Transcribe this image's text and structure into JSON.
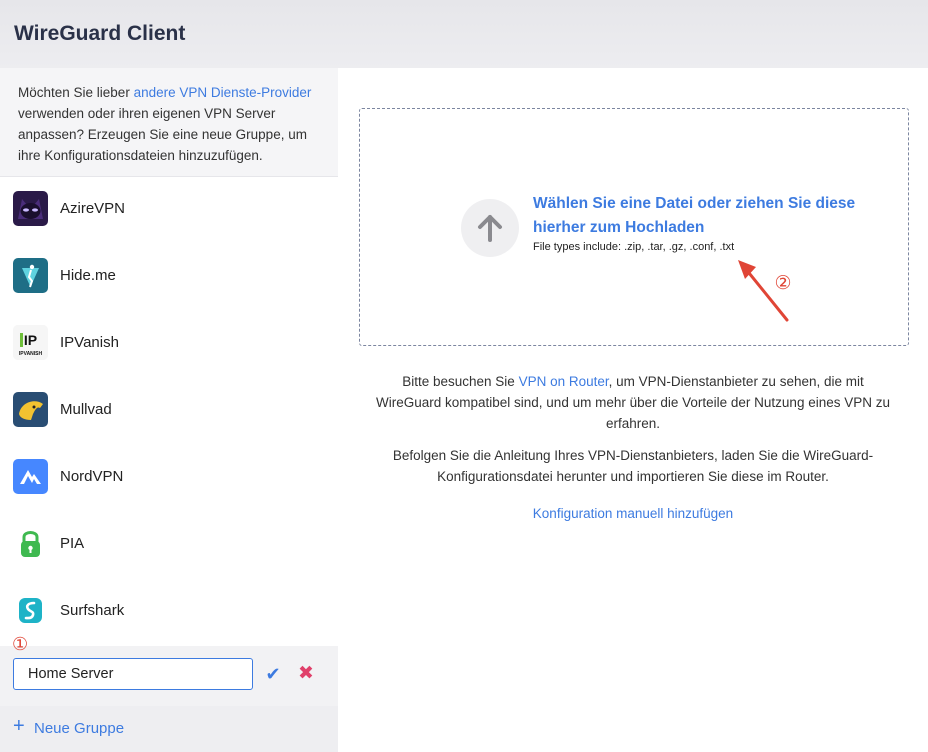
{
  "app": {
    "title": "WireGuard Client"
  },
  "sidebar": {
    "intro": {
      "before": "Möchten Sie lieber ",
      "link": "andere VPN Dienste-Provider",
      "after": " verwenden oder ihren eigenen VPN Server anpassen? Erzeugen Sie eine neue Gruppe, um ihre Konfigurationsdateien hinzuzufügen."
    },
    "providers": [
      {
        "name": "AzireVPN",
        "icon": "azirevpn-logo",
        "color": "#2d1a4e"
      },
      {
        "name": "Hide.me",
        "icon": "hideme-logo",
        "color": "#1f6f86"
      },
      {
        "name": "IPVanish",
        "icon": "ipvanish-logo",
        "color": "#111111",
        "logo_text": "IPVANISH"
      },
      {
        "name": "Mullvad",
        "icon": "mullvad-logo",
        "color": "#294d73"
      },
      {
        "name": "NordVPN",
        "icon": "nordvpn-logo",
        "color": "#4687ff"
      },
      {
        "name": "PIA",
        "icon": "pia-logo",
        "color": "#3fb950"
      },
      {
        "name": "Surfshark",
        "icon": "surfshark-logo",
        "color": "#1fb4c8"
      }
    ],
    "group_input": {
      "value": "Home Server",
      "placeholder": ""
    },
    "new_group_label": "Neue Gruppe"
  },
  "main": {
    "upload": {
      "title": "Wählen Sie eine Datei oder ziehen Sie diese hierher zum Hochladen",
      "filetypes": "File types include:  .zip, .tar, .gz, .conf, .txt"
    },
    "info1": {
      "before": "Bitte besuchen Sie ",
      "link": "VPN on Router",
      "after": ", um VPN-Dienstanbieter zu sehen, die mit WireGuard kompatibel sind, und um mehr über die Vorteile der Nutzung eines VPN zu erfahren."
    },
    "info2": "Befolgen Sie die Anleitung Ihres VPN-Dienstanbieters, laden Sie die WireGuard-Konfigurationsdatei herunter und importieren Sie diese im Router.",
    "manual_link": "Konfiguration manuell hinzufügen"
  },
  "annotations": {
    "marker1": "①",
    "marker2": "②",
    "color": "#e04536"
  },
  "colors": {
    "accent": "#3d7be0",
    "danger": "#e0406a"
  }
}
